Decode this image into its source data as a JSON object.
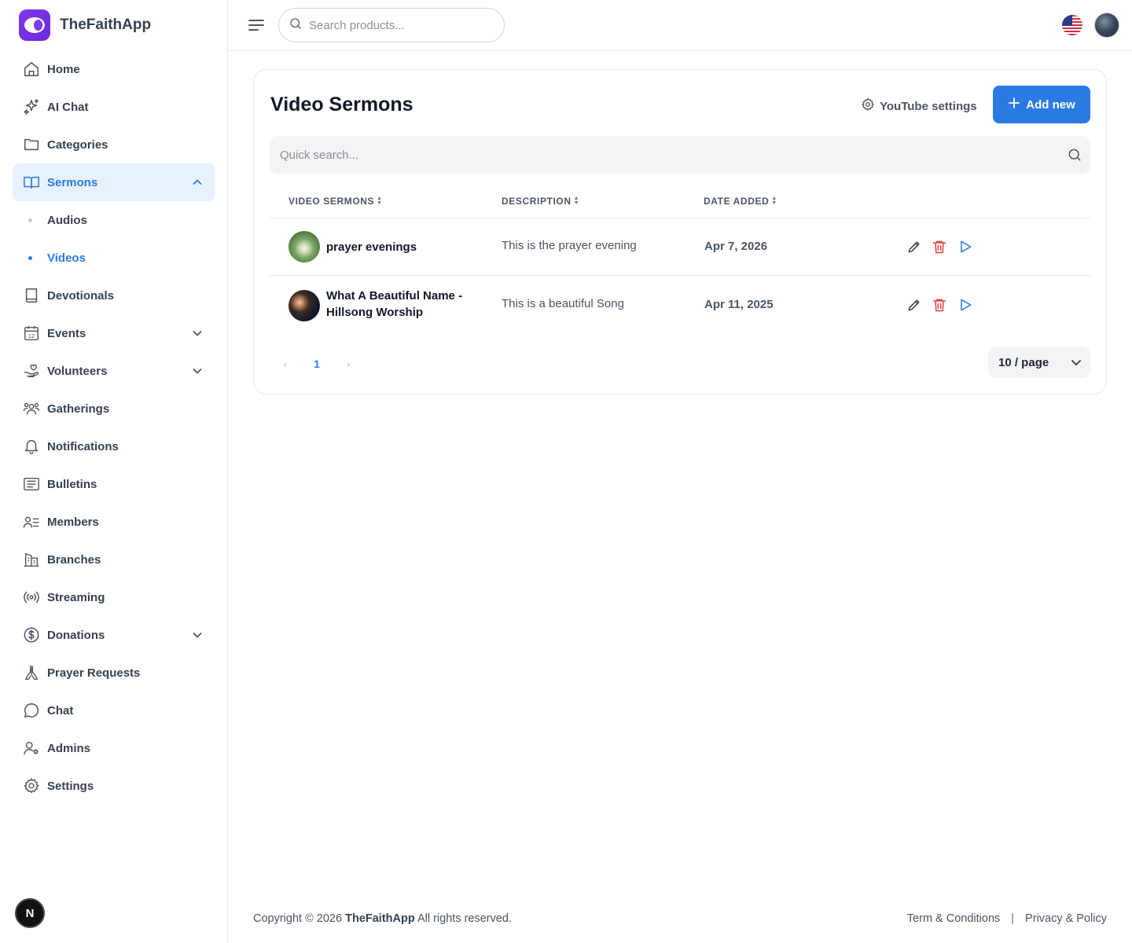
{
  "brand": {
    "name": "TheFaithApp"
  },
  "colors": {
    "accent": "#2a7ae4",
    "brand": "#7c3aed",
    "danger": "#e53e3e"
  },
  "sidebar": {
    "items": [
      {
        "label": "Home",
        "icon": "home-icon"
      },
      {
        "label": "AI Chat",
        "icon": "sparkles-icon"
      },
      {
        "label": "Categories",
        "icon": "folder-icon"
      },
      {
        "label": "Sermons",
        "icon": "book-open-icon",
        "active": true,
        "expanded": true,
        "children": [
          {
            "label": "Audios"
          },
          {
            "label": "Videos",
            "active": true
          }
        ]
      },
      {
        "label": "Devotionals",
        "icon": "book-icon"
      },
      {
        "label": "Events",
        "icon": "calendar-icon",
        "calendar_day": "12"
      },
      {
        "label": "Volunteers",
        "icon": "hand-heart-icon"
      },
      {
        "label": "Gatherings",
        "icon": "users-icon"
      },
      {
        "label": "Notifications",
        "icon": "bell-icon"
      },
      {
        "label": "Bulletins",
        "icon": "newspaper-icon"
      },
      {
        "label": "Members",
        "icon": "user-list-icon"
      },
      {
        "label": "Branches",
        "icon": "building-icon"
      },
      {
        "label": "Streaming",
        "icon": "broadcast-icon"
      },
      {
        "label": "Donations",
        "icon": "dollar-icon"
      },
      {
        "label": "Prayer Requests",
        "icon": "praying-hands-icon"
      },
      {
        "label": "Chat",
        "icon": "chat-bubble-icon"
      },
      {
        "label": "Admins",
        "icon": "user-cog-icon"
      },
      {
        "label": "Settings",
        "icon": "gear-icon"
      }
    ],
    "fab_label": "N"
  },
  "header": {
    "search_placeholder": "Search products..."
  },
  "page": {
    "title": "Video Sermons",
    "youtube_settings_label": "YouTube settings",
    "add_new_label": "Add new",
    "quick_search_placeholder": "Quick search...",
    "columns": [
      "VIDEO SERMONS",
      "DESCRIPTION",
      "DATE ADDED"
    ],
    "rows": [
      {
        "name": "prayer evenings",
        "description": "This is the prayer evening",
        "date": "Apr 7, 2026"
      },
      {
        "name": "What A Beautiful Name - Hillsong Worship",
        "description": "This is a beautiful Song",
        "date": "Apr 11, 2025"
      }
    ],
    "pagination": {
      "current_page": "1",
      "prev": "‹",
      "next": "›",
      "page_size": "10 / page"
    }
  },
  "footer": {
    "copyright_prefix": "Copyright © 2026",
    "copyright_brand": "TheFaithApp",
    "copyright_suffix": "All rights reserved.",
    "links": [
      "Term & Conditions",
      "Privacy & Policy"
    ],
    "separator": "|"
  }
}
